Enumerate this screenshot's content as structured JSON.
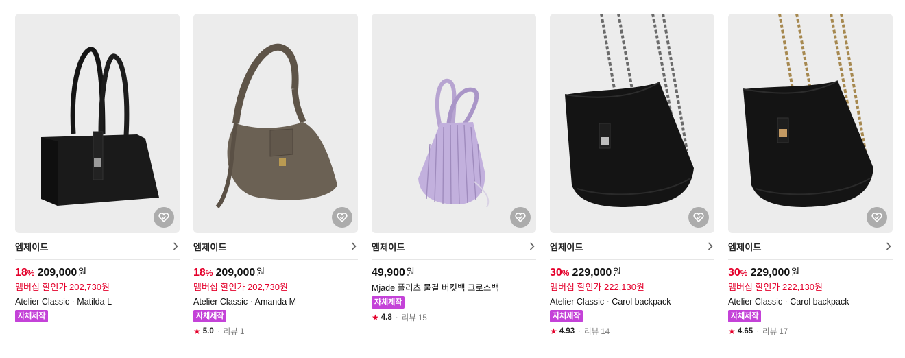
{
  "products": [
    {
      "brand": "엠제이드",
      "discount": "18",
      "pct": "%",
      "price": "209,000",
      "won": "원",
      "member_price": "멤버십 할인가 202,730원",
      "name": "Atelier Classic · Matilda L",
      "badge": "자체제작",
      "rating": null
    },
    {
      "brand": "엠제이드",
      "discount": "18",
      "pct": "%",
      "price": "209,000",
      "won": "원",
      "member_price": "멤버십 할인가 202,730원",
      "name": "Atelier Classic · Amanda M",
      "badge": "자체제작",
      "rating": {
        "score": "5.0",
        "reviews": "리뷰 1"
      }
    },
    {
      "brand": "엠제이드",
      "discount": "",
      "pct": "",
      "price": "49,900",
      "won": "원",
      "member_price": "",
      "name": "Mjade 플리츠 물결 버킷백 크로스백",
      "badge": "자체제작",
      "rating": {
        "score": "4.8",
        "reviews": "리뷰 15"
      }
    },
    {
      "brand": "엠제이드",
      "discount": "30",
      "pct": "%",
      "price": "229,000",
      "won": "원",
      "member_price": "멤버십 할인가 222,130원",
      "name": "Atelier Classic · Carol backpack",
      "badge": "자체제작",
      "rating": {
        "score": "4.93",
        "reviews": "리뷰 14"
      }
    },
    {
      "brand": "엠제이드",
      "discount": "30",
      "pct": "%",
      "price": "229,000",
      "won": "원",
      "member_price": "멤버십 할인가 222,130원",
      "name": "Atelier Classic · Carol backpack",
      "badge": "자체제작",
      "rating": {
        "score": "4.65",
        "reviews": "리뷰 17"
      }
    }
  ],
  "icons": {
    "like": "heart-icon",
    "chevron": "chevron-right-icon",
    "star": "star-icon"
  },
  "colors": {
    "discount": "#e4002b",
    "badge": "#c442d8",
    "thumb_bg": "#ececec"
  }
}
